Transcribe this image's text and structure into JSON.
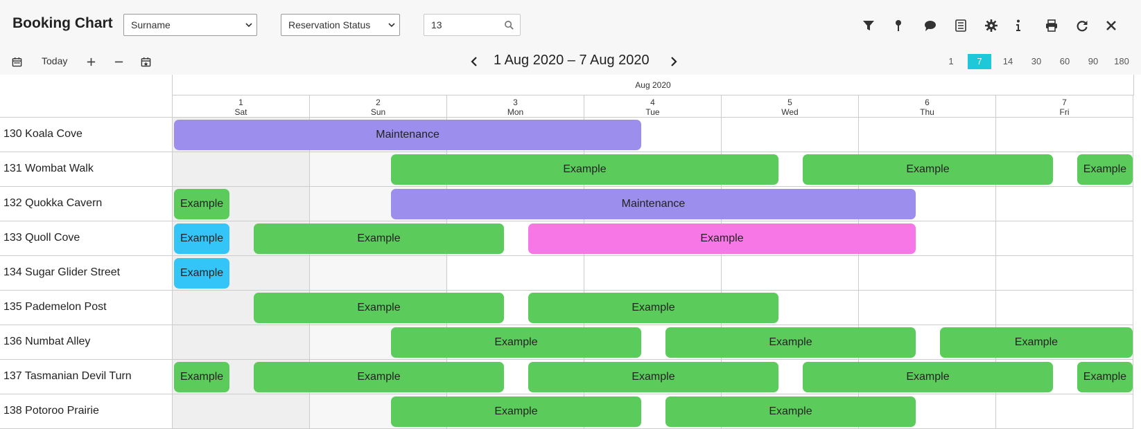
{
  "app": {
    "title": "Booking Chart"
  },
  "filters": {
    "sort_select": "Surname",
    "status_select": "Reservation Status",
    "search_value": "13"
  },
  "toolbar_icons": [
    "filter-icon",
    "pin-icon",
    "comment-icon",
    "list-icon",
    "gear-icon",
    "info-icon",
    "print-icon",
    "refresh-icon",
    "close-icon"
  ],
  "nav": {
    "today_label": "Today",
    "range_label": "1 Aug 2020 – 7 Aug 2020",
    "zoom_options": [
      "1",
      "7",
      "14",
      "30",
      "60",
      "90",
      "180"
    ],
    "zoom_selected": "7",
    "accent_color": "#1ec8d8"
  },
  "header": {
    "month": "Aug 2020",
    "days": [
      {
        "num": "1",
        "dow": "Sat"
      },
      {
        "num": "2",
        "dow": "Sun"
      },
      {
        "num": "3",
        "dow": "Mon"
      },
      {
        "num": "4",
        "dow": "Tue"
      },
      {
        "num": "5",
        "dow": "Wed"
      },
      {
        "num": "6",
        "dow": "Thu"
      },
      {
        "num": "7",
        "dow": "Fri"
      }
    ]
  },
  "colors": {
    "green": "#5bcc5b",
    "purple": "#9b8eec",
    "pink": "#f877e6",
    "blue": "#33c5f8"
  },
  "rooms": [
    {
      "name": "130 Koala Cove",
      "bookings": [
        {
          "label": "Maintenance",
          "color": "purple",
          "start": 0,
          "end": 3.42
        }
      ]
    },
    {
      "name": "131 Wombat Walk",
      "bookings": [
        {
          "label": "Example",
          "color": "green",
          "start": 1.58,
          "end": 4.42
        },
        {
          "label": "Example",
          "color": "green",
          "start": 4.58,
          "end": 6.42
        },
        {
          "label": "Example",
          "color": "green",
          "start": 6.58,
          "end": 7
        }
      ]
    },
    {
      "name": "132 Quokka Cavern",
      "bookings": [
        {
          "label": "Example",
          "color": "green",
          "start": 0,
          "end": 0.42
        },
        {
          "label": "Maintenance",
          "color": "purple",
          "start": 1.58,
          "end": 5.42
        }
      ]
    },
    {
      "name": "133 Quoll Cove",
      "bookings": [
        {
          "label": "Example",
          "color": "blue",
          "start": 0,
          "end": 0.42
        },
        {
          "label": "Example",
          "color": "green",
          "start": 0.58,
          "end": 2.42
        },
        {
          "label": "Example",
          "color": "pink",
          "start": 2.58,
          "end": 5.42
        }
      ]
    },
    {
      "name": "134 Sugar Glider Street",
      "bookings": [
        {
          "label": "Example",
          "color": "blue",
          "start": 0,
          "end": 0.42
        }
      ]
    },
    {
      "name": "135 Pademelon Post",
      "bookings": [
        {
          "label": "Example",
          "color": "green",
          "start": 0.58,
          "end": 2.42
        },
        {
          "label": "Example",
          "color": "green",
          "start": 2.58,
          "end": 4.42
        }
      ]
    },
    {
      "name": "136 Numbat Alley",
      "bookings": [
        {
          "label": "Example",
          "color": "green",
          "start": 1.58,
          "end": 3.42
        },
        {
          "label": "Example",
          "color": "green",
          "start": 3.58,
          "end": 5.42
        },
        {
          "label": "Example",
          "color": "green",
          "start": 5.58,
          "end": 7
        }
      ]
    },
    {
      "name": "137 Tasmanian Devil Turn",
      "bookings": [
        {
          "label": "Example",
          "color": "green",
          "start": 0,
          "end": 0.42
        },
        {
          "label": "Example",
          "color": "green",
          "start": 0.58,
          "end": 2.42
        },
        {
          "label": "Example",
          "color": "green",
          "start": 2.58,
          "end": 4.42
        },
        {
          "label": "Example",
          "color": "green",
          "start": 4.58,
          "end": 6.42
        },
        {
          "label": "Example",
          "color": "green",
          "start": 6.58,
          "end": 7
        }
      ]
    },
    {
      "name": "138 Potoroo Prairie",
      "bookings": [
        {
          "label": "Example",
          "color": "green",
          "start": 1.58,
          "end": 3.42
        },
        {
          "label": "Example",
          "color": "green",
          "start": 3.58,
          "end": 5.42
        }
      ]
    }
  ]
}
